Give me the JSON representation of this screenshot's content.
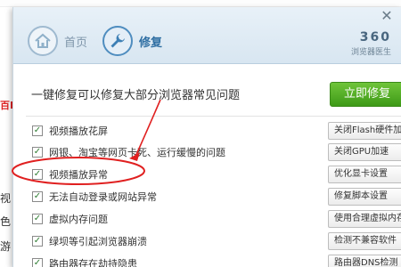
{
  "background": {
    "left_fragments": [
      "百B",
      "视",
      "色",
      "游"
    ]
  },
  "window": {
    "close_glyph": "✕",
    "nav": {
      "home_label": "首页",
      "repair_label": "修复"
    },
    "logo": {
      "main": "360",
      "sub": "浏览器医生"
    },
    "subheading": "一键修复可以修复大部分浏览器常见问题",
    "fix_button_label": "立即修复",
    "items": [
      {
        "label": "视频播放花屏",
        "action": "关闭Flash硬件加速",
        "checked": true
      },
      {
        "label": "网银、淘宝等网页卡死、运行缓慢的问题",
        "action": "关闭GPU加速",
        "checked": true
      },
      {
        "label": "视频播放异常",
        "action": "优化显卡设置",
        "checked": true
      },
      {
        "label": "无法自动登录或网站异常",
        "action": "修复脚本设置",
        "checked": true
      },
      {
        "label": "虚拟内存问题",
        "action": "使用合理虚拟内存",
        "checked": true
      },
      {
        "label": "绿坝等引起浏览器崩溃",
        "action": "检测不兼容软件",
        "checked": true
      },
      {
        "label": "路由器存在劫持隐患",
        "action": "路由器DNS检测",
        "checked": true
      }
    ]
  },
  "annotation": {
    "color": "#e02020",
    "highlighted_item": "视频播放异常"
  }
}
